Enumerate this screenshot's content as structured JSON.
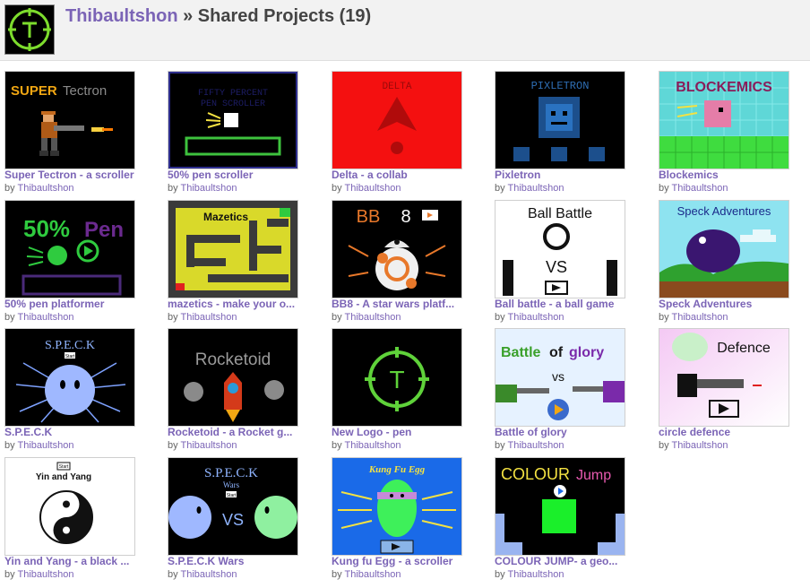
{
  "header": {
    "username": "Thibaultshon",
    "separator": " » ",
    "heading": "Shared Projects (19)"
  },
  "colors": {
    "link": "#7b64b6",
    "header_bg": "#f2f2f2",
    "logo_green": "#7ddc2d"
  },
  "projects": [
    {
      "title": "Super Tectron - a scroller",
      "by": "by",
      "author": "Thibaultshon",
      "thumb_text": [
        "SUPER",
        "Tectron"
      ]
    },
    {
      "title": "50% pen scroller",
      "by": "by",
      "author": "Thibaultshon",
      "thumb_text": [
        "FIFTY PERCENT",
        "PEN SCROLLER"
      ]
    },
    {
      "title": "Delta - a collab",
      "by": "by",
      "author": "Thibaultshon",
      "thumb_text": [
        "DELTA"
      ]
    },
    {
      "title": "Pixletron",
      "by": "by",
      "author": "Thibaultshon",
      "thumb_text": [
        "PIXLETRON"
      ]
    },
    {
      "title": "Blockemics",
      "by": "by",
      "author": "Thibaultshon",
      "thumb_text": [
        "BLOCKEMICS"
      ]
    },
    {
      "title": "50% pen platformer",
      "by": "by",
      "author": "Thibaultshon",
      "thumb_text": [
        "50%",
        "Pen"
      ]
    },
    {
      "title": "mazetics - make your o...",
      "by": "by",
      "author": "Thibaultshon",
      "thumb_text": [
        "Mazetics"
      ]
    },
    {
      "title": "BB8 - A star wars platf...",
      "by": "by",
      "author": "Thibaultshon",
      "thumb_text": [
        "BB",
        "8"
      ]
    },
    {
      "title": "Ball battle - a ball game",
      "by": "by",
      "author": "Thibaultshon",
      "thumb_text": [
        "Ball Battle",
        "VS"
      ]
    },
    {
      "title": "Speck Adventures",
      "by": "by",
      "author": "Thibaultshon",
      "thumb_text": [
        "Speck Adventures"
      ]
    },
    {
      "title": "S.P.E.C.K",
      "by": "by",
      "author": "Thibaultshon",
      "thumb_text": [
        "S.P.E.C.K",
        "Start"
      ]
    },
    {
      "title": "Rocketoid - a Rocket g...",
      "by": "by",
      "author": "Thibaultshon",
      "thumb_text": [
        "Rocketoid"
      ]
    },
    {
      "title": "New Logo - pen",
      "by": "by",
      "author": "Thibaultshon",
      "thumb_text": [
        "T"
      ]
    },
    {
      "title": "Battle of glory",
      "by": "by",
      "author": "Thibaultshon",
      "thumb_text": [
        "Battle",
        "of",
        "glory",
        "vs"
      ]
    },
    {
      "title": "circle defence",
      "by": "by",
      "author": "Thibaultshon",
      "thumb_text": [
        "Defence"
      ]
    },
    {
      "title": "Yin and Yang - a black ...",
      "by": "by",
      "author": "Thibaultshon",
      "thumb_text": [
        "Start",
        "Yin and Yang"
      ]
    },
    {
      "title": "S.P.E.C.K Wars",
      "by": "by",
      "author": "Thibaultshon",
      "thumb_text": [
        "S.P.E.C.K",
        "Wars",
        "Start",
        "VS"
      ]
    },
    {
      "title": "Kung fu Egg - a scroller",
      "by": "by",
      "author": "Thibaultshon",
      "thumb_text": [
        "Kung Fu Egg"
      ]
    },
    {
      "title": "COLOUR JUMP- a geo...",
      "by": "by",
      "author": "Thibaultshon",
      "thumb_text": [
        "COLOUR",
        "Jump"
      ]
    }
  ]
}
